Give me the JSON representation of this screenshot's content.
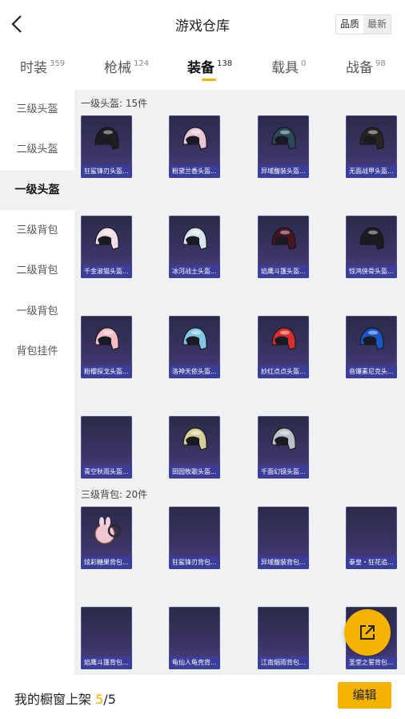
{
  "header": {
    "title": "游戏仓库",
    "back_icon": "chevron-left-icon"
  },
  "sort": {
    "quality": "品质",
    "latest": "最新",
    "selected": "品质"
  },
  "tabs": [
    {
      "label": "时装",
      "count": "359"
    },
    {
      "label": "枪械",
      "count": "124"
    },
    {
      "label": "装备",
      "count": "138",
      "active": true
    },
    {
      "label": "载具",
      "count": "0"
    },
    {
      "label": "战备",
      "count": "98"
    }
  ],
  "sidebar": [
    {
      "label": "三级头盔"
    },
    {
      "label": "二级头盔"
    },
    {
      "label": "一级头盔",
      "active": true
    },
    {
      "label": "三级背包"
    },
    {
      "label": "二级背包"
    },
    {
      "label": "一级背包"
    },
    {
      "label": "背包挂件"
    }
  ],
  "sections": [
    {
      "title": "一级头盔: 15件",
      "items": [
        {
          "name": "狂鲨锋刃头盔...",
          "color": "#1e1e24"
        },
        {
          "name": "粉黛兰香头盔...",
          "color": "#e8c6d2"
        },
        {
          "name": "异域馥装头盔...",
          "color": "#2a4a5a"
        },
        {
          "name": "无面战甲头盔...",
          "color": "#2a2522"
        },
        {
          "name": "千金淑猫头盔...",
          "color": "#f2dce6"
        },
        {
          "name": "冰河战士头盔...",
          "color": "#d8e4ef"
        },
        {
          "name": "焰鹰斗篷头盔...",
          "color": "#4a1420"
        },
        {
          "name": "惊鸿侠骨头盔...",
          "color": "#1c1c20"
        },
        {
          "name": "粉樱探戈头盔...",
          "color": "#f5bcc6"
        },
        {
          "name": "洛神天依头盔...",
          "color": "#7fc8e4"
        },
        {
          "name": "妙红点点头盔...",
          "color": "#d42f2f"
        },
        {
          "name": "音爆素尼克头...",
          "color": "#1a55c8"
        },
        {
          "name": "青空秋雨头盔...",
          "color": ""
        },
        {
          "name": "田园牧歌头盔...",
          "color": "#d4cf98"
        },
        {
          "name": "千面幻镜头盔...",
          "color": "#b9c0c6"
        }
      ]
    },
    {
      "title": "三级背包: 20件",
      "items": [
        {
          "name": "炫彩糖果背包...",
          "color": "#f1c6d4"
        },
        {
          "name": "狂鲨锋刃背包...",
          "color": ""
        },
        {
          "name": "异域馥装背包...",
          "color": ""
        },
        {
          "name": "拳皇・狂花追...",
          "color": ""
        },
        {
          "name": "焰鹰斗篷背包...",
          "color": ""
        },
        {
          "name": "龟仙人龟壳背...",
          "color": ""
        },
        {
          "name": "江南烟雨背包...",
          "color": ""
        },
        {
          "name": "圣堂之誓背包...",
          "color": ""
        }
      ]
    }
  ],
  "bottom": {
    "label": "我的橱窗上架",
    "current": "5",
    "total": "/5",
    "edit": "编辑",
    "share_icon": "share-icon"
  },
  "colors": {
    "accent": "#f5b301",
    "card_bg": "#3a3464",
    "card_label": "#3c3f9a"
  }
}
